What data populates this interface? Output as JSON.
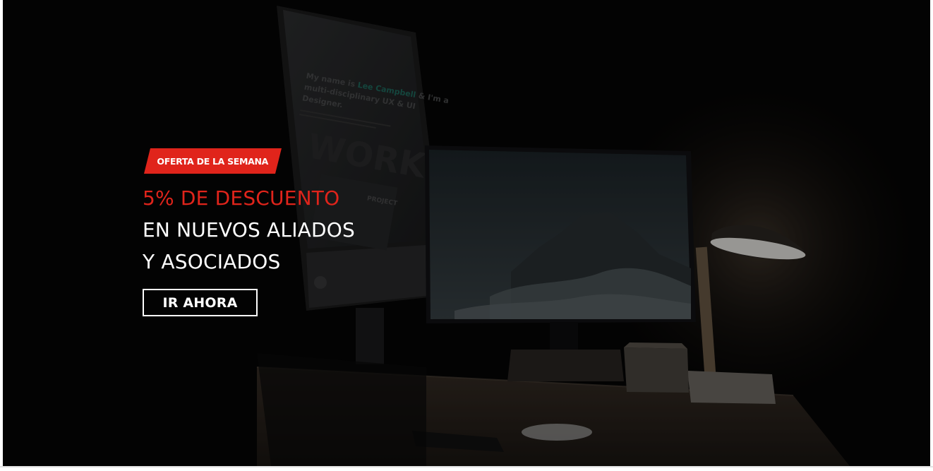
{
  "hero": {
    "badge_label": "OFERTA DE LA SEMANA",
    "headline_accent": "5% DE DESCUENTO",
    "headline_line_2": "EN NUEVOS ALIADOS",
    "headline_line_3": "Y ASOCIADOS",
    "cta_label": "IR AHORA"
  },
  "background_screen": {
    "text_prefix": "My name is ",
    "text_highlight": "Lee Campbell",
    "text_suffix_1": " & I'm a",
    "text_line_2": "multi-disciplinary UX & UI",
    "text_line_3": "Designer.",
    "watermark": "WORK",
    "project_label": "PROJECT"
  },
  "colors": {
    "accent": "#e0241b",
    "text": "#ffffff",
    "background": "#050505"
  }
}
